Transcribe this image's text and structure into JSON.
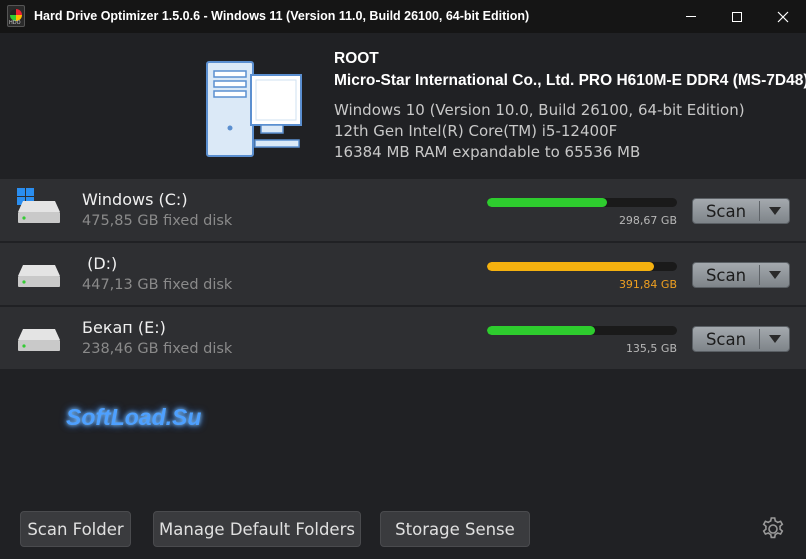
{
  "window": {
    "title": "Hard Drive Optimizer 1.5.0.6 - Windows 11 (Version 11.0, Build 26100, 64-bit Edition)",
    "icon_text": "HDO"
  },
  "system": {
    "name": "ROOT",
    "model": "Micro-Star International Co., Ltd. PRO H610M-E DDR4 (MS-7D48)",
    "os": "Windows 10 (Version 10.0, Build 26100, 64-bit Edition)",
    "cpu": "12th Gen Intel(R) Core(TM) i5-12400F",
    "ram": "16384 MB RAM expandable to 65536 MB"
  },
  "drives": [
    {
      "name": "Windows (C:)",
      "desc": "475,85 GB fixed disk",
      "free": "298,67 GB",
      "fill_percent": 63,
      "bar_color": "#2ecc2e",
      "free_color": "#b8b8b8",
      "scan_label": "Scan",
      "system_drive": true
    },
    {
      "name": " (D:)",
      "desc": "447,13 GB fixed disk",
      "free": "391,84 GB",
      "fill_percent": 88,
      "bar_color": "#f5b10f",
      "free_color": "#f0a020",
      "scan_label": "Scan",
      "system_drive": false
    },
    {
      "name": "Бекап (E:)",
      "desc": "238,46 GB fixed disk",
      "free": "135,5 GB",
      "fill_percent": 57,
      "bar_color": "#2ecc2e",
      "free_color": "#b8b8b8",
      "scan_label": "Scan",
      "system_drive": false
    }
  ],
  "watermark": "SoftLoad.Su",
  "bottom": {
    "scan_folder": "Scan Folder",
    "manage_default_folders": "Manage Default Folders",
    "storage_sense": "Storage Sense"
  },
  "icons": {
    "settings": "gear-icon",
    "computer": "computer-icon",
    "drive": "hard-drive-icon",
    "windows": "windows-logo-icon"
  }
}
